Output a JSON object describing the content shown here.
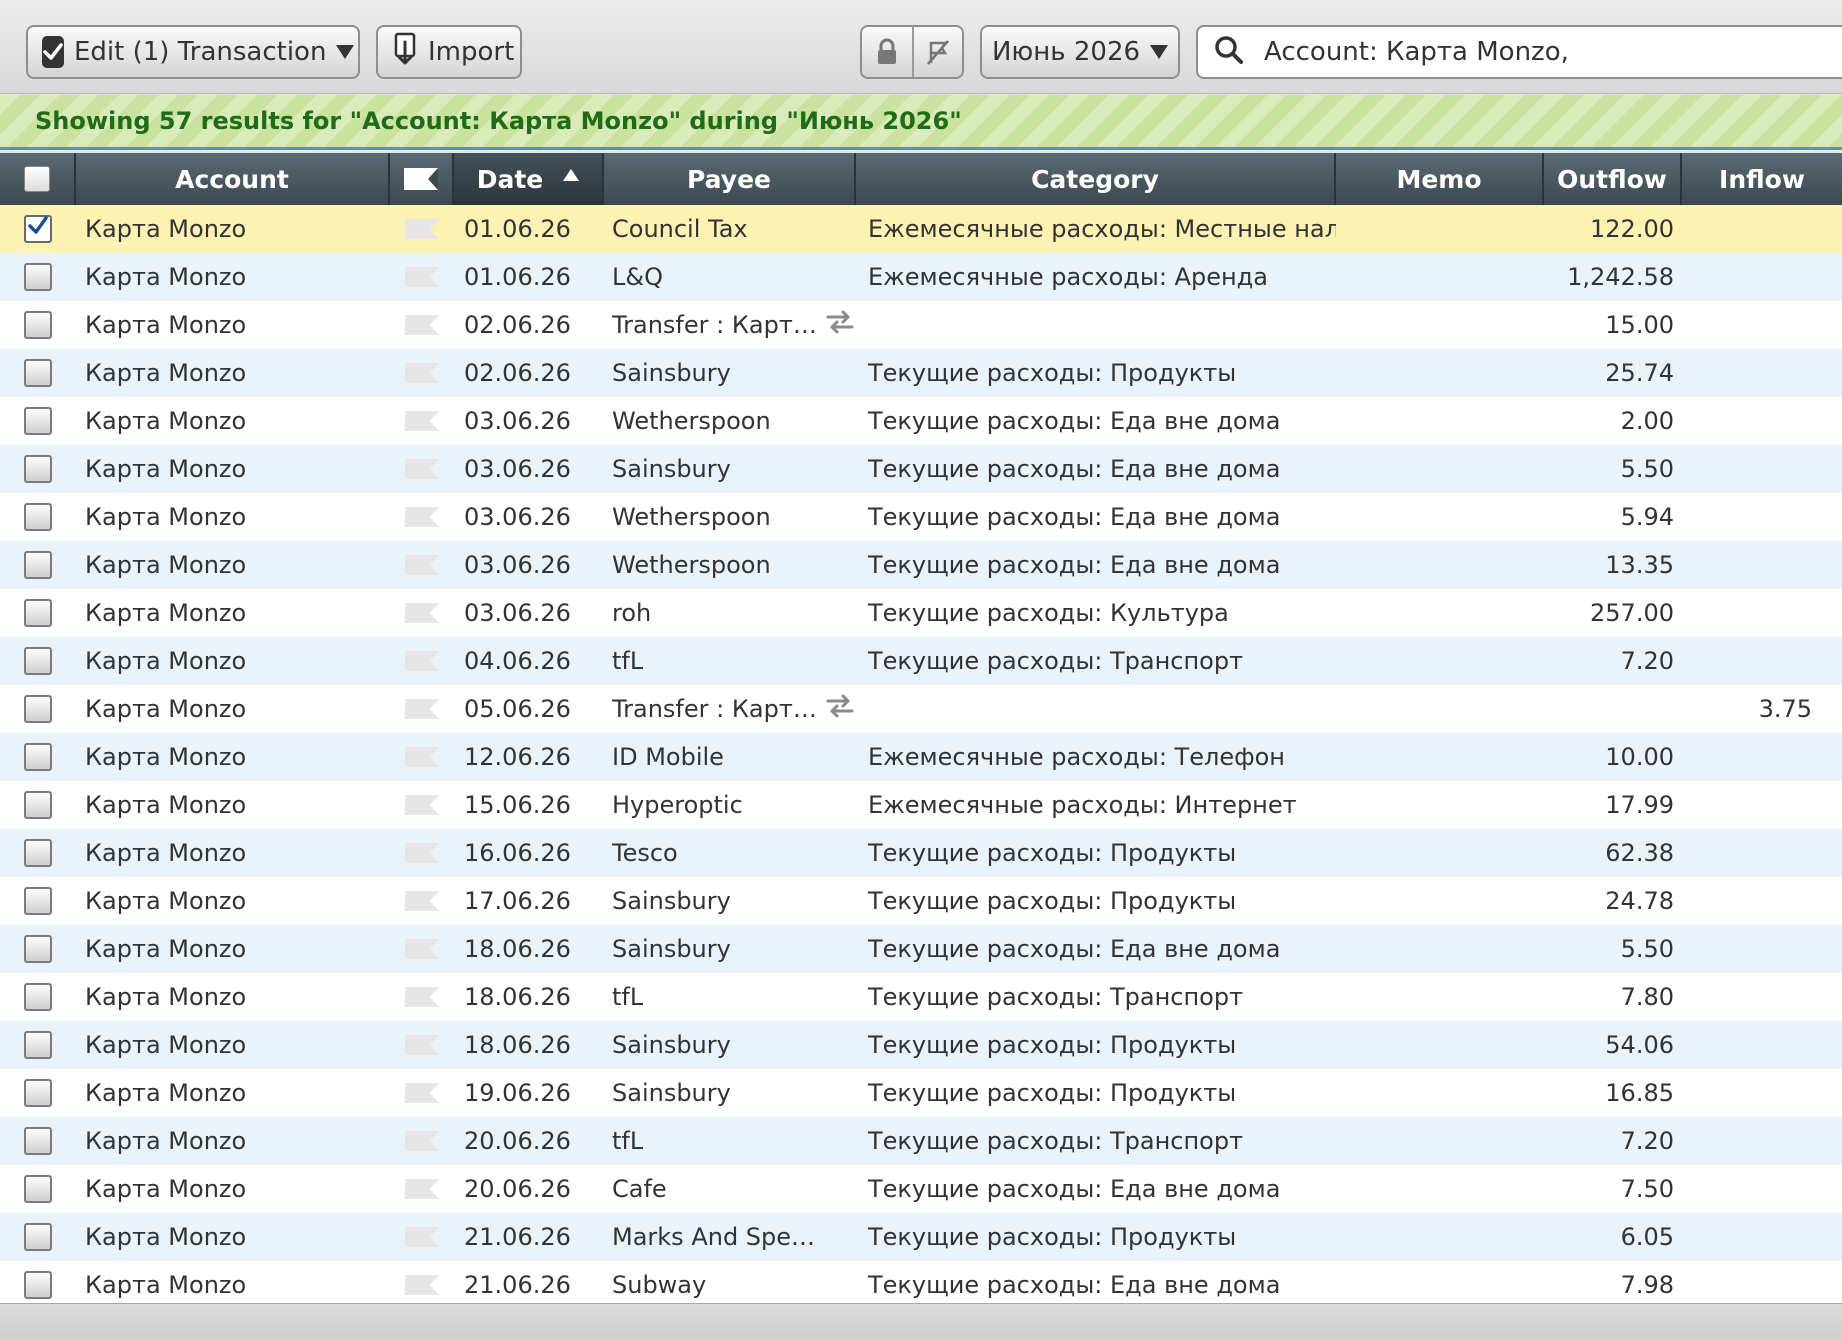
{
  "toolbar": {
    "edit_label": "Edit (1) Transaction",
    "import_label": "Import",
    "month_label": "Июнь 2026",
    "search_value": "Account: Карта Monzo,"
  },
  "banner": {
    "text": "Showing 57 results for \"Account: Карта Monzo\" during \"Июнь 2026\""
  },
  "columns": {
    "account": "Account",
    "date": "Date",
    "payee": "Payee",
    "category": "Category",
    "memo": "Memo",
    "outflow": "Outflow",
    "inflow": "Inflow"
  },
  "colors": {
    "selected_row": "#fbf2b3",
    "alt_row": "#eaf3fa",
    "banner_text": "#1f6b17",
    "header_bg": "#3c4850"
  },
  "rows": [
    {
      "checked": true,
      "account": "Карта Monzo",
      "date": "01.06.26",
      "payee": "Council Tax",
      "transfer": false,
      "category": "Ежемесячные расходы: Местные налоги",
      "memo": "",
      "outflow": "122.00",
      "inflow": ""
    },
    {
      "checked": false,
      "account": "Карта Monzo",
      "date": "01.06.26",
      "payee": "L&Q",
      "transfer": false,
      "category": "Ежемесячные расходы: Аренда",
      "memo": "",
      "outflow": "1,242.58",
      "inflow": ""
    },
    {
      "checked": false,
      "account": "Карта Monzo",
      "date": "02.06.26",
      "payee": "Transfer : Карта R...",
      "transfer": true,
      "category": "",
      "memo": "",
      "outflow": "15.00",
      "inflow": ""
    },
    {
      "checked": false,
      "account": "Карта Monzo",
      "date": "02.06.26",
      "payee": "Sainsbury",
      "transfer": false,
      "category": "Текущие расходы: Продукты",
      "memo": "",
      "outflow": "25.74",
      "inflow": ""
    },
    {
      "checked": false,
      "account": "Карта Monzo",
      "date": "03.06.26",
      "payee": "Wetherspoon",
      "transfer": false,
      "category": "Текущие расходы: Еда вне дома",
      "memo": "",
      "outflow": "2.00",
      "inflow": ""
    },
    {
      "checked": false,
      "account": "Карта Monzo",
      "date": "03.06.26",
      "payee": "Sainsbury",
      "transfer": false,
      "category": "Текущие расходы: Еда вне дома",
      "memo": "",
      "outflow": "5.50",
      "inflow": ""
    },
    {
      "checked": false,
      "account": "Карта Monzo",
      "date": "03.06.26",
      "payee": "Wetherspoon",
      "transfer": false,
      "category": "Текущие расходы: Еда вне дома",
      "memo": "",
      "outflow": "5.94",
      "inflow": ""
    },
    {
      "checked": false,
      "account": "Карта Monzo",
      "date": "03.06.26",
      "payee": "Wetherspoon",
      "transfer": false,
      "category": "Текущие расходы: Еда вне дома",
      "memo": "",
      "outflow": "13.35",
      "inflow": ""
    },
    {
      "checked": false,
      "account": "Карта Monzo",
      "date": "03.06.26",
      "payee": "roh",
      "transfer": false,
      "category": "Текущие расходы: Культура",
      "memo": "",
      "outflow": "257.00",
      "inflow": ""
    },
    {
      "checked": false,
      "account": "Карта Monzo",
      "date": "04.06.26",
      "payee": "tfL",
      "transfer": false,
      "category": "Текущие расходы: Транспорт",
      "memo": "",
      "outflow": "7.20",
      "inflow": ""
    },
    {
      "checked": false,
      "account": "Карта Monzo",
      "date": "05.06.26",
      "payee": "Transfer : Карта R...",
      "transfer": true,
      "category": "",
      "memo": "",
      "outflow": "",
      "inflow": "3.75"
    },
    {
      "checked": false,
      "account": "Карта Monzo",
      "date": "12.06.26",
      "payee": "ID Mobile",
      "transfer": false,
      "category": "Ежемесячные расходы: Телефон",
      "memo": "",
      "outflow": "10.00",
      "inflow": ""
    },
    {
      "checked": false,
      "account": "Карта Monzo",
      "date": "15.06.26",
      "payee": "Hyperoptic",
      "transfer": false,
      "category": "Ежемесячные расходы: Интернет",
      "memo": "",
      "outflow": "17.99",
      "inflow": ""
    },
    {
      "checked": false,
      "account": "Карта Monzo",
      "date": "16.06.26",
      "payee": "Tesco",
      "transfer": false,
      "category": "Текущие расходы: Продукты",
      "memo": "",
      "outflow": "62.38",
      "inflow": ""
    },
    {
      "checked": false,
      "account": "Карта Monzo",
      "date": "17.06.26",
      "payee": "Sainsbury",
      "transfer": false,
      "category": "Текущие расходы: Продукты",
      "memo": "",
      "outflow": "24.78",
      "inflow": ""
    },
    {
      "checked": false,
      "account": "Карта Monzo",
      "date": "18.06.26",
      "payee": "Sainsbury",
      "transfer": false,
      "category": "Текущие расходы: Еда вне дома",
      "memo": "",
      "outflow": "5.50",
      "inflow": ""
    },
    {
      "checked": false,
      "account": "Карта Monzo",
      "date": "18.06.26",
      "payee": "tfL",
      "transfer": false,
      "category": "Текущие расходы: Транспорт",
      "memo": "",
      "outflow": "7.80",
      "inflow": ""
    },
    {
      "checked": false,
      "account": "Карта Monzo",
      "date": "18.06.26",
      "payee": "Sainsbury",
      "transfer": false,
      "category": "Текущие расходы: Продукты",
      "memo": "",
      "outflow": "54.06",
      "inflow": ""
    },
    {
      "checked": false,
      "account": "Карта Monzo",
      "date": "19.06.26",
      "payee": "Sainsbury",
      "transfer": false,
      "category": "Текущие расходы: Продукты",
      "memo": "",
      "outflow": "16.85",
      "inflow": ""
    },
    {
      "checked": false,
      "account": "Карта Monzo",
      "date": "20.06.26",
      "payee": "tfL",
      "transfer": false,
      "category": "Текущие расходы: Транспорт",
      "memo": "",
      "outflow": "7.20",
      "inflow": ""
    },
    {
      "checked": false,
      "account": "Карта Monzo",
      "date": "20.06.26",
      "payee": "Cafe",
      "transfer": false,
      "category": "Текущие расходы: Еда вне дома",
      "memo": "",
      "outflow": "7.50",
      "inflow": ""
    },
    {
      "checked": false,
      "account": "Карта Monzo",
      "date": "21.06.26",
      "payee": "Marks And Spencer",
      "transfer": false,
      "category": "Текущие расходы: Продукты",
      "memo": "",
      "outflow": "6.05",
      "inflow": ""
    },
    {
      "checked": false,
      "account": "Карта Monzo",
      "date": "21.06.26",
      "payee": "Subway",
      "transfer": false,
      "category": "Текущие расходы: Еда вне дома",
      "memo": "",
      "outflow": "7.98",
      "inflow": ""
    }
  ]
}
